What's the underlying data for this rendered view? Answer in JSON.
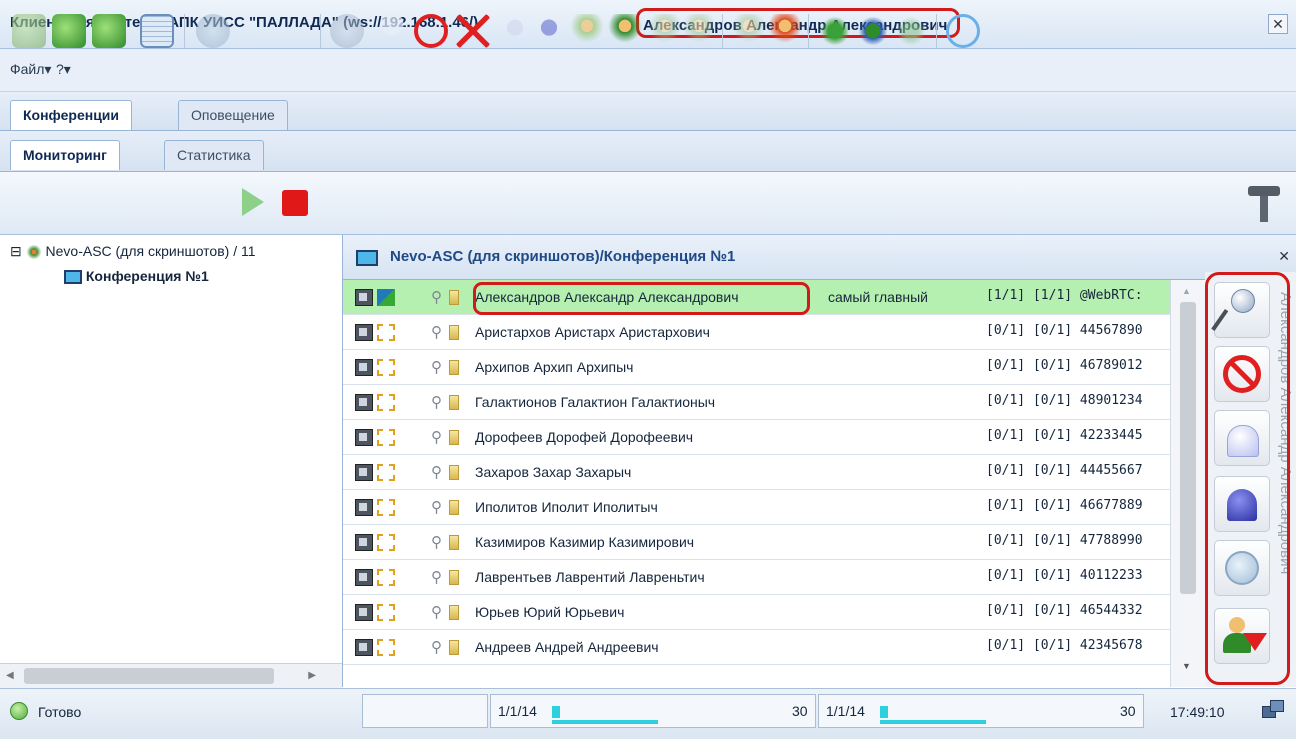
{
  "window": {
    "title": "Клиент для системы АПК УИСС \"ПАЛЛАДА\" (ws://192.168.1.46/)",
    "title_user": "Александров Александр Александрович",
    "close_symbol": "✕"
  },
  "menu": {
    "file": "Файл▾",
    "help": "?▾"
  },
  "tabs_main": [
    "Конференции",
    "Оповещение"
  ],
  "tabs_sub": [
    "Мониторинг",
    "Статистика"
  ],
  "tree": {
    "root": "Nevo-ASC (для скриншотов) / 11",
    "child": "Конференция №1",
    "expand_symbol": "⊟"
  },
  "main": {
    "title": "Nevo-ASC (для скриншотов)/Конференция №1",
    "close_symbol": "✕"
  },
  "participants": [
    {
      "name": "Александров Александр Александрович",
      "role": "самый главный",
      "status": "[1/1] [1/1] @WebRTC:"
    },
    {
      "name": "Аристархов Аристарх Аристархович",
      "role": "",
      "status": "[0/1] [0/1] 44567890"
    },
    {
      "name": "Архипов Архип Архипыч",
      "role": "",
      "status": "[0/1] [0/1] 46789012"
    },
    {
      "name": "Галактионов Галактион Галактионыч",
      "role": "",
      "status": "[0/1] [0/1] 48901234"
    },
    {
      "name": "Дорофеев Дорофей Дорофеевич",
      "role": "",
      "status": "[0/1] [0/1] 42233445"
    },
    {
      "name": "Захаров Захар Захарыч",
      "role": "",
      "status": "[0/1] [0/1] 44455667"
    },
    {
      "name": "Иполитов Иполит Иполитыч",
      "role": "",
      "status": "[0/1] [0/1] 46677889"
    },
    {
      "name": "Казимиров Казимир Казимирович",
      "role": "",
      "status": "[0/1] [0/1] 47788990"
    },
    {
      "name": "Лаврентьев Лаврентий Лавреньтич",
      "role": "",
      "status": "[0/1] [0/1] 40112233"
    },
    {
      "name": "Юрьев Юрий Юрьевич",
      "role": "",
      "status": "[0/1] [0/1] 46544332"
    },
    {
      "name": "Андреев Андрей Андреевич",
      "role": "",
      "status": "[0/1] [0/1] 42345678"
    }
  ],
  "side_panel": {
    "vertical_label": "Александров Александр Александрович"
  },
  "status": {
    "ready": "Готово",
    "pager1_label": "1/1/14",
    "pager1_value": "30",
    "pager2_label": "1/1/14",
    "pager2_value": "30",
    "time": "17:49:10"
  }
}
